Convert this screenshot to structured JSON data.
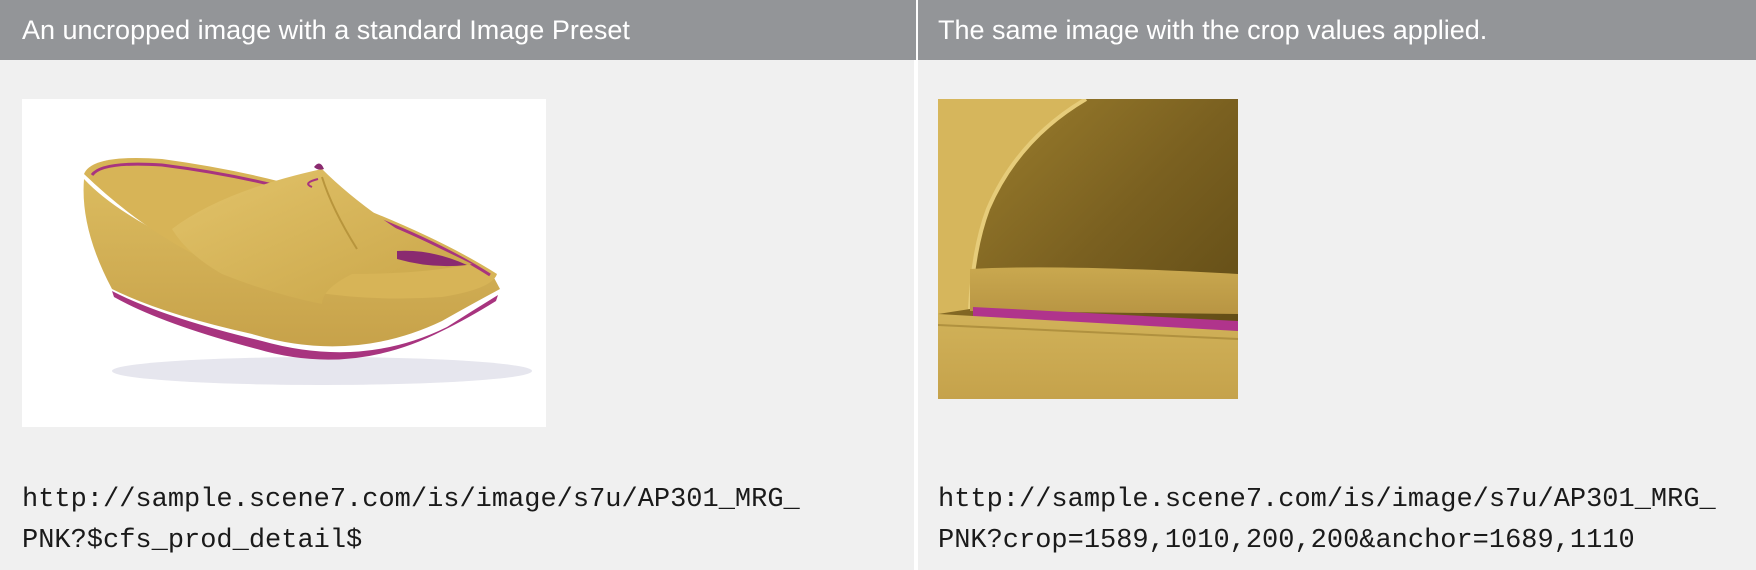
{
  "header": {
    "left": "An uncropped image with a standard Image Preset",
    "right": "The same image with the crop values applied."
  },
  "left_cell": {
    "url_line1": "http://sample.scene7.com/is/image/s7u/AP301_MRG_",
    "url_line2": "PNK?$cfs_prod_detail$"
  },
  "right_cell": {
    "url_line1": "http://sample.scene7.com/is/image/s7u/AP301_MRG_",
    "url_line2": "PNK?crop=1589,1010,200,200&anchor=1689,1110"
  },
  "colors": {
    "header_bg": "#939598",
    "cell_bg": "#f0f0f0",
    "shoe_yellow": "#d9b75a",
    "shoe_magenta": "#b0308a"
  }
}
